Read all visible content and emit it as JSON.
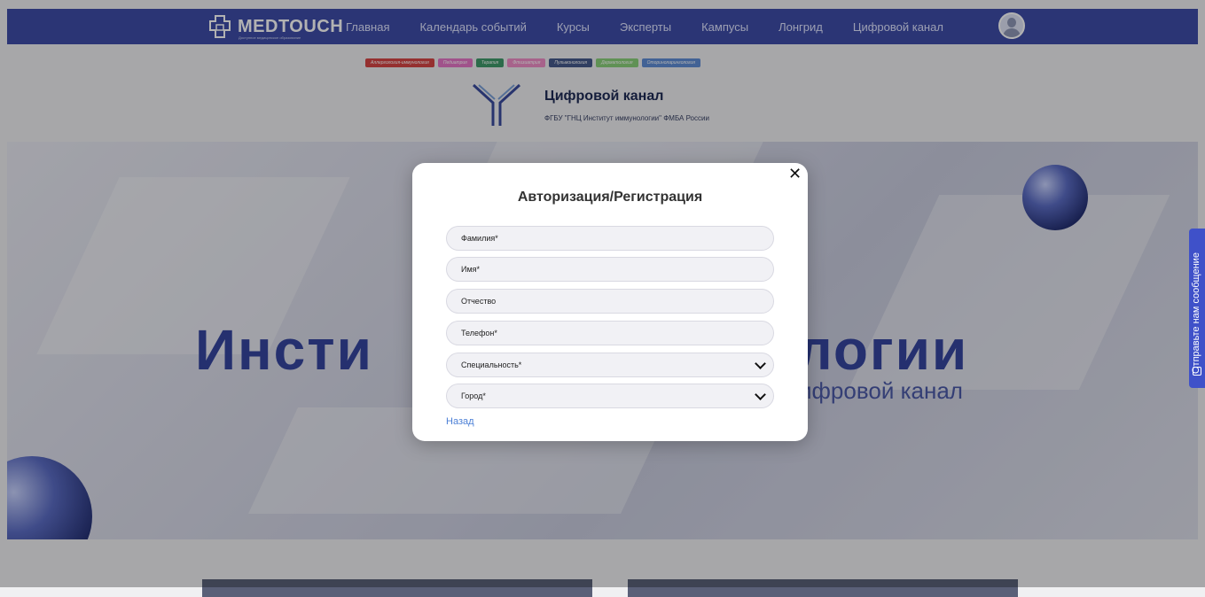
{
  "header": {
    "logo_text": "MEDTOUCH",
    "logo_sub": "Доступное медицинское образование",
    "nav": [
      "Главная",
      "Календарь событий",
      "Курсы",
      "Эксперты",
      "Кампусы",
      "Лонгрид",
      "Цифровой канал"
    ]
  },
  "tags": [
    {
      "label": "Аллергология-иммунология",
      "color": "#d64545"
    },
    {
      "label": "Педиатрия",
      "color": "#e676c8"
    },
    {
      "label": "Терапия",
      "color": "#3f9a6a"
    },
    {
      "label": "Фтизиатрия",
      "color": "#f08fc8"
    },
    {
      "label": "Пульмонология",
      "color": "#465a8c"
    },
    {
      "label": "Дерматология",
      "color": "#8ad07a"
    },
    {
      "label": "Оториноларингология",
      "color": "#5f8dd6"
    }
  ],
  "channel": {
    "title": "Цифровой канал",
    "subtitle": "ФГБУ \"ГНЦ Институт иммунологии\" ФМБА России"
  },
  "hero": {
    "title_left": "Инсти",
    "title_right": "логии",
    "subtitle_right": "ифровой канал"
  },
  "side_tab": {
    "label": "Отправьте нам сообщение"
  },
  "modal": {
    "title": "Авторизация/Регистрация",
    "fields": [
      "Фамилия*",
      "Имя*",
      "Отчество",
      "Телефон*",
      "Специальность*",
      "Город*"
    ],
    "back_label": "Назад"
  },
  "colors": {
    "brand": "#3e4da8",
    "link": "#4b7fd6",
    "accent_tab": "#3f51c9"
  }
}
